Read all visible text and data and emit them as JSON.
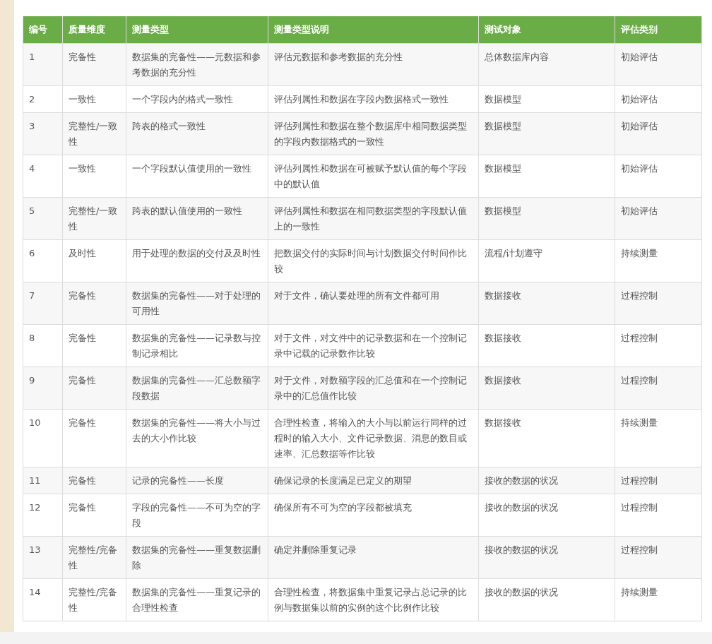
{
  "table": {
    "columns": [
      "编号",
      "质量维度",
      "测量类型",
      "测量类型说明",
      "测试对象",
      "评估类别"
    ],
    "rows": [
      [
        "1",
        "完备性",
        "数据集的完备性——元数据和参考数据的充分性",
        "评估元数据和参考数据的充分性",
        "总体数据库内容",
        "初始评估"
      ],
      [
        "2",
        "一致性",
        "一个字段内的格式一致性",
        "评估列属性和数据在字段内数据格式一致性",
        "数据模型",
        "初始评估"
      ],
      [
        "3",
        "完整性/一致性",
        "跨表的格式一致性",
        "评估列属性和数据在整个数据库中相同数据类型的字段内数据格式的一致性",
        "数据模型",
        "初始评估"
      ],
      [
        "4",
        "一致性",
        "一个字段默认值使用的一致性",
        "评估列属性和数据在可被赋予默认值的每个字段中的默认值",
        "数据模型",
        "初始评估"
      ],
      [
        "5",
        "完整性/一致性",
        "跨表的默认值使用的一致性",
        "评估列属性和数据在相同数据类型的字段默认值上的一致性",
        "数据模型",
        "初始评估"
      ],
      [
        "6",
        "及时性",
        "用于处理的数据的交付及及时性",
        "把数据交付的实际时间与计划数据交付时间作比较",
        "流程/计划遵守",
        "持续测量"
      ],
      [
        "7",
        "完备性",
        "数据集的完备性——对于处理的可用性",
        "对于文件，确认要处理的所有文件都可用",
        "数据接收",
        "过程控制"
      ],
      [
        "8",
        "完备性",
        "数据集的完备性——记录数与控制记录相比",
        "对于文件，对文件中的记录数据和在一个控制记录中记载的记录数作比较",
        "数据接收",
        "过程控制"
      ],
      [
        "9",
        "完备性",
        "数据集的完备性——汇总数额字段数据",
        "对于文件，对数额字段的汇总值和在一个控制记录中的汇总值作比较",
        "数据接收",
        "过程控制"
      ],
      [
        "10",
        "完备性",
        "数据集的完备性——将大小与过去的大小作比较",
        "合理性检查，将输入的大小与以前运行同样的过程时的输入大小、文件记录数据、消息的数目或速率、汇总数据等作比较",
        "数据接收",
        "持续测量"
      ],
      [
        "11",
        "完备性",
        "记录的完备性——长度",
        "确保记录的长度满足已定义的期望",
        "接收的数据的状况",
        "过程控制"
      ],
      [
        "12",
        "完备性",
        "字段的完备性——不可为空的字段",
        "确保所有不可为空的字段都被填充",
        "接收的数据的状况",
        "过程控制"
      ],
      [
        "13",
        "完整性/完备性",
        "数据集的完备性——重复数据删除",
        "确定并删除重复记录",
        "接收的数据的状况",
        "过程控制"
      ],
      [
        "14",
        "完整性/完备性",
        "数据集的完备性——重复记录的合理性检查",
        "合理性检查，将数据集中重复记录占总记录的比例与数据集以前的实例的这个比例作比较",
        "接收的数据的状况",
        "持续测量"
      ]
    ]
  }
}
